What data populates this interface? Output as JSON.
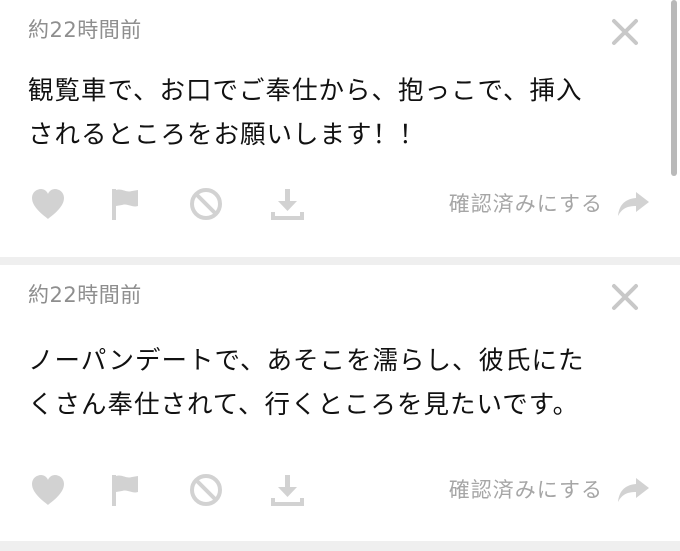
{
  "notifications": [
    {
      "time": "約22時間前",
      "lines": [
        "観覧車で、お口でご奉仕から、抱っこで、挿入",
        "されるところをお願いします！！"
      ],
      "confirm_label": "確認済みにする"
    },
    {
      "time": "約22時間前",
      "lines": [
        "ノーパンデートで、あそこを濡らし、彼氏にた",
        "くさん奉仕されて、行くところを見たいです。"
      ],
      "confirm_label": "確認済みにする"
    }
  ],
  "icons": {
    "like": "heart-icon",
    "report": "flag-icon",
    "block": "ban-icon",
    "save": "download-icon",
    "share": "share-arrow-icon",
    "dismiss": "close-icon"
  },
  "colors": {
    "icon": "#d2d2d2",
    "time_text": "#8e8e8e",
    "confirm_text": "#a6a6a6",
    "body_text": "#111111",
    "divider": "#efefef"
  }
}
